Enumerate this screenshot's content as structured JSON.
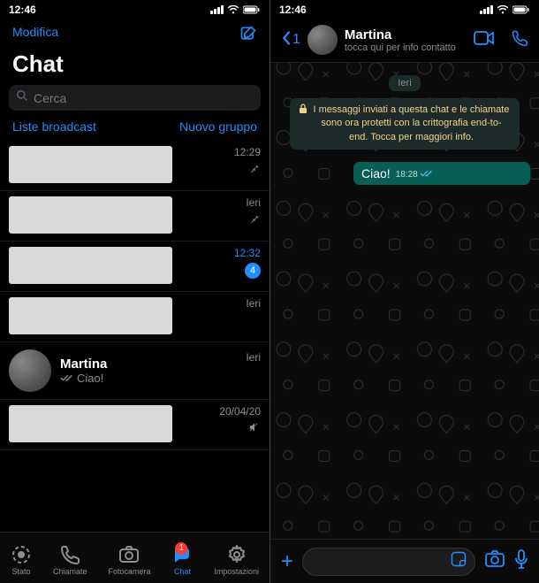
{
  "status": {
    "time": "12:46"
  },
  "left": {
    "edit": "Modifica",
    "title": "Chat",
    "search_placeholder": "Cerca",
    "broadcast": "Liste broadcast",
    "new_group": "Nuovo gruppo",
    "rows": [
      {
        "time": "12:29",
        "indicator": "pin"
      },
      {
        "time": "Ieri",
        "indicator": "pin"
      },
      {
        "time": "12:32",
        "indicator": "badge",
        "badge": "4"
      },
      {
        "time": "Ieri",
        "indicator": "none"
      }
    ],
    "martina": {
      "name": "Martina",
      "preview": "Ciao!",
      "time": "Ieri"
    },
    "last_row": {
      "time": "20/04/20",
      "indicator": "mute"
    },
    "tabs": {
      "stato": "Stato",
      "chiamate": "Chiamate",
      "fotocamera": "Fotocamera",
      "chat": "Chat",
      "chat_badge": "1",
      "impostazioni": "Impostazioni"
    }
  },
  "right": {
    "back_count": "1",
    "name": "Martina",
    "subtitle": "tocca qui per info contatto",
    "date_chip": "Ieri",
    "encryption": "I messaggi inviati a questa chat e le chiamate sono ora protetti con la crittografia end-to-end. Tocca per maggiori info.",
    "message": {
      "text": "Ciao!",
      "time": "18:28"
    }
  }
}
